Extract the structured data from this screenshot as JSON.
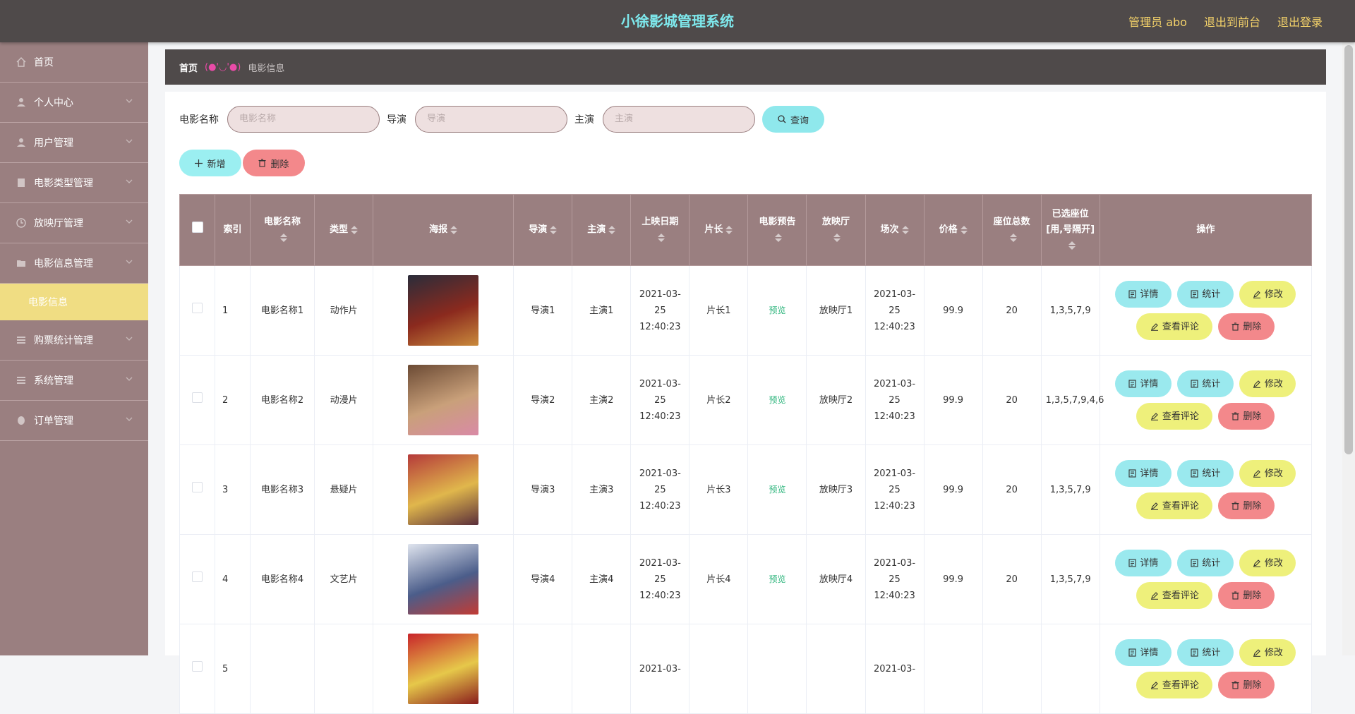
{
  "header": {
    "title": "小徐影城管理系统",
    "user": "管理员 abo",
    "to_front": "退出到前台",
    "logout": "退出登录"
  },
  "sidebar": {
    "items": [
      {
        "label": "首页",
        "icon": "home-icon"
      },
      {
        "label": "个人中心",
        "icon": "user-icon"
      },
      {
        "label": "用户管理",
        "icon": "user-icon"
      },
      {
        "label": "电影类型管理",
        "icon": "document-icon"
      },
      {
        "label": "放映厅管理",
        "icon": "clock-icon"
      },
      {
        "label": "电影信息管理",
        "icon": "folder-icon"
      }
    ],
    "active_sub": "电影信息",
    "items_after": [
      {
        "label": "购票统计管理",
        "icon": "list-icon"
      },
      {
        "label": "系统管理",
        "icon": "menu-icon"
      },
      {
        "label": "订单管理",
        "icon": "record-icon"
      }
    ]
  },
  "breadcrumb": {
    "home": "首页",
    "separator": "(●'◡'●)",
    "current": "电影信息"
  },
  "search": {
    "name_label": "电影名称",
    "name_placeholder": "电影名称",
    "director_label": "导演",
    "director_placeholder": "导演",
    "actor_label": "主演",
    "actor_placeholder": "主演",
    "query_button": "查询"
  },
  "actions": {
    "add": "新增",
    "delete": "删除"
  },
  "table": {
    "headers": {
      "index": "索引",
      "name": "电影名称",
      "type": "类型",
      "poster": "海报",
      "director": "导演",
      "actor": "主演",
      "date": "上映日期",
      "duration": "片长",
      "trailer": "电影预告",
      "hall": "放映厅",
      "session": "场次",
      "price": "价格",
      "seats": "座位总数",
      "selected": "已选座位[用,号隔开]",
      "ops": "操作"
    },
    "rows": [
      {
        "index": "1",
        "name": "电影名称1",
        "type": "动作片",
        "director": "导演1",
        "actor": "主演1",
        "date": "2021-03-25 12:40:23",
        "duration": "片长1",
        "trailer": "预览",
        "hall": "放映厅1",
        "session": "2021-03-25 12:40:23",
        "price": "99.9",
        "seats": "20",
        "selected": "1,3,5,7,9",
        "poster_colors": [
          "#2a2c3a",
          "#8b2a1e",
          "#c98a3c"
        ]
      },
      {
        "index": "2",
        "name": "电影名称2",
        "type": "动漫片",
        "director": "导演2",
        "actor": "主演2",
        "date": "2021-03-25 12:40:23",
        "duration": "片长2",
        "trailer": "预览",
        "hall": "放映厅2",
        "session": "2021-03-25 12:40:23",
        "price": "99.9",
        "seats": "20",
        "selected": "1,3,5,7,9,4,6",
        "poster_colors": [
          "#6b4a34",
          "#c9a07a",
          "#d98aa6"
        ]
      },
      {
        "index": "3",
        "name": "电影名称3",
        "type": "悬疑片",
        "director": "导演3",
        "actor": "主演3",
        "date": "2021-03-25 12:40:23",
        "duration": "片长3",
        "trailer": "预览",
        "hall": "放映厅3",
        "session": "2021-03-25 12:40:23",
        "price": "99.9",
        "seats": "20",
        "selected": "1,3,5,7,9",
        "poster_colors": [
          "#b53a3a",
          "#e0b74c",
          "#5a2e3a"
        ]
      },
      {
        "index": "4",
        "name": "电影名称4",
        "type": "文艺片",
        "director": "导演4",
        "actor": "主演4",
        "date": "2021-03-25 12:40:23",
        "duration": "片长4",
        "trailer": "预览",
        "hall": "放映厅4",
        "session": "2021-03-25 12:40:23",
        "price": "99.9",
        "seats": "20",
        "selected": "1,3,5,7,9",
        "poster_colors": [
          "#dfe4ee",
          "#4b5d8a",
          "#c23b34"
        ]
      },
      {
        "index": "5",
        "name": "",
        "type": "",
        "director": "",
        "actor": "",
        "date": "2021-03-",
        "duration": "",
        "trailer": "",
        "hall": "",
        "session": "2021-03-",
        "price": "",
        "seats": "",
        "selected": "",
        "poster_colors": [
          "#c8242a",
          "#e6c84a",
          "#8a1c1c"
        ]
      }
    ],
    "op_labels": {
      "detail": "详情",
      "stat": "统计",
      "edit": "修改",
      "review": "查看评论",
      "delete": "删除"
    }
  },
  "colors": {
    "header": "#4f4a4a",
    "sidebar": "#9a7f80",
    "active_sub": "#f0dd83",
    "title": "#7ee8ec",
    "link": "#f5d36a"
  }
}
